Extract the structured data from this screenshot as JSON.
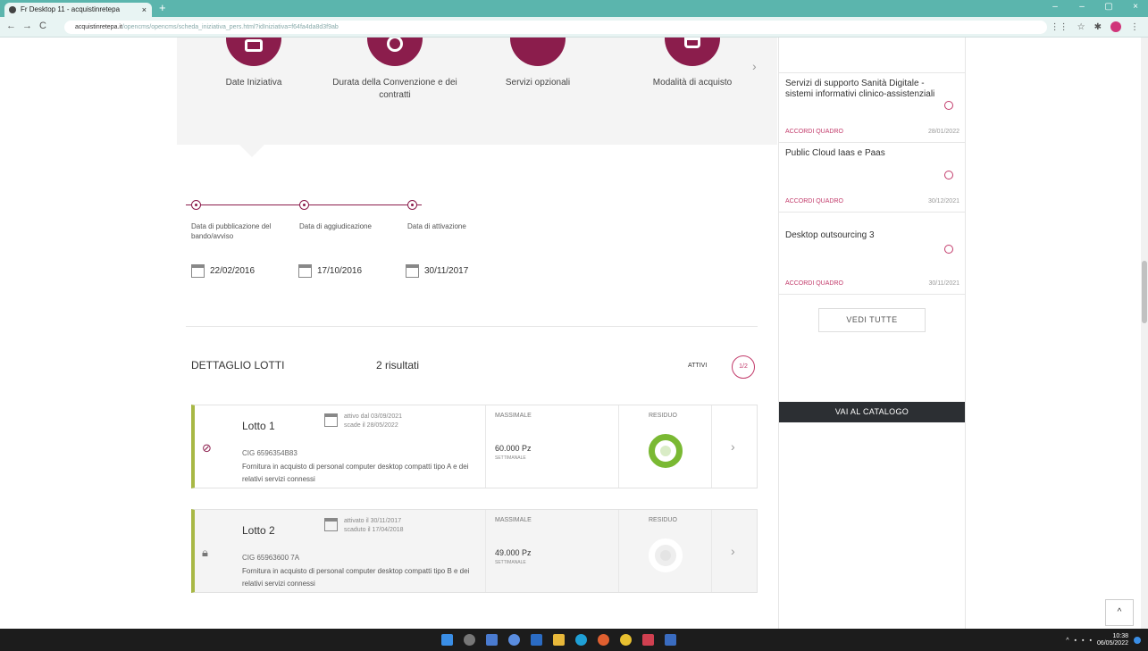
{
  "browser": {
    "tab_title": "Fr Desktop 11 - acquistinretepa",
    "tab_close": "×",
    "new_tab": "+",
    "url_host": "acquistinretepa.it",
    "url_path": "/opencms/opencms/scheda_iniziativa_pers.html?idIniziativa=f64fa4da8d3f9ab",
    "nav_back": "←",
    "nav_forward": "→",
    "nav_reload": "C",
    "win_min": "–",
    "win_restore": "–",
    "win_max": "▢",
    "win_close": "×"
  },
  "features": [
    {
      "label": "Date Iniziativa",
      "icon": "calendar-icon"
    },
    {
      "label": "Durata della Convenzione e dei contratti",
      "icon": "clock-icon"
    },
    {
      "label": "Servizi opzionali",
      "icon": "services-icon"
    },
    {
      "label": "Modalità di acquisto",
      "icon": "cart-icon"
    }
  ],
  "features_next": "›",
  "timeline": {
    "labels": [
      "Data di pubblicazione del bando/avviso",
      "Data di aggiudicazione",
      "Data di attivazione"
    ],
    "dates": [
      "22/02/2016",
      "17/10/2016",
      "30/11/2017"
    ]
  },
  "lotti": {
    "title": "DETTAGLIO LOTTI",
    "count": "2 risultati",
    "filter_label": "ATTIVI",
    "filter_value": "1/2",
    "items": [
      {
        "name": "Lotto 1",
        "status": "active",
        "dates_line1": "attivo dal 03/09/2021",
        "dates_line2": "scade il 28/05/2022",
        "cig": "CIG 6596354B83",
        "desc": "Fornitura in acquisto di personal computer desktop compatti tipo A e dei relativi servizi connessi",
        "massimale_label": "MASSIMALE",
        "massimale_value": "60.000 Pz",
        "massimale_unit": "SETTIMANALE",
        "residuo_label": "RESIDUO",
        "residuo_percent": 95
      },
      {
        "name": "Lotto 2",
        "status": "locked",
        "dates_line1": "attivato il 30/11/2017",
        "dates_line2": "scaduto il 17/04/2018",
        "cig": "CIG 65963600 7A",
        "desc": "Fornitura in acquisto di personal computer desktop compatti tipo B e dei relativi servizi connessi",
        "massimale_label": "MASSIMALE",
        "massimale_value": "49.000 Pz",
        "massimale_unit": "SETTIMANALE",
        "residuo_label": "RESIDUO",
        "residuo_percent": 0
      }
    ],
    "arrow": "›"
  },
  "sidebar": {
    "items": [
      {
        "title": "Servizi di supporto Sanità Digitale - sistemi informativi clinico-assistenziali",
        "category": "ACCORDI QUADRO",
        "date": "28/01/2022"
      },
      {
        "title": "Public Cloud Iaas e Paas",
        "category": "ACCORDI QUADRO",
        "date": "30/12/2021"
      },
      {
        "title": "Desktop outsourcing 3",
        "category": "ACCORDI QUADRO",
        "date": "30/11/2021"
      }
    ],
    "vedi_tutte": "VEDI TUTTE",
    "catalog_button": "VAI AL CATALOGO"
  },
  "totop": "^",
  "taskbar": {
    "clock_time": "10:38",
    "clock_date": "06/05/2022"
  },
  "colors": {
    "brand": "#8b1d4c",
    "accent_pink": "#c23a6a",
    "lot_border": "#a8b845",
    "residuo_green": "#7ab933",
    "titlebar": "#5bb5ad"
  }
}
